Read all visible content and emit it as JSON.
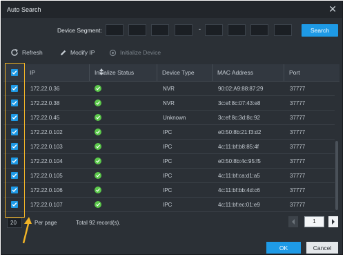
{
  "dialog": {
    "title": "Auto Search"
  },
  "segment": {
    "label": "Device Segment:",
    "separator": "-"
  },
  "actions": {
    "search": "Search",
    "ok": "OK",
    "cancel": "Cancel"
  },
  "toolbar": {
    "refresh": "Refresh",
    "modify_ip": "Modify IP",
    "initialize_device": "Initialize Device"
  },
  "table": {
    "columns": [
      "IP",
      "Initialize Status",
      "Device Type",
      "MAC Address",
      "Port"
    ],
    "rows": [
      {
        "ip": "172.22.0.36",
        "status": "initialized",
        "type": "NVR",
        "mac": "90:02:A9:88:87:29",
        "port": "37777"
      },
      {
        "ip": "172.22.0.38",
        "status": "initialized",
        "type": "NVR",
        "mac": "3c:ef:8c:07:43:e8",
        "port": "37777"
      },
      {
        "ip": "172.22.0.45",
        "status": "initialized",
        "type": "Unknown",
        "mac": "3c:ef:8c:3d:8c:92",
        "port": "37777"
      },
      {
        "ip": "172.22.0.102",
        "status": "initialized",
        "type": "IPC",
        "mac": "e0:50:8b:21:f3:d2",
        "port": "37777"
      },
      {
        "ip": "172.22.0.103",
        "status": "initialized",
        "type": "IPC",
        "mac": "4c:11:bf:b8:85:4f",
        "port": "37777"
      },
      {
        "ip": "172.22.0.104",
        "status": "initialized",
        "type": "IPC",
        "mac": "e0:50:8b:4c:95:f5",
        "port": "37777"
      },
      {
        "ip": "172.22.0.105",
        "status": "initialized",
        "type": "IPC",
        "mac": "4c:11:bf:ca:d1:a5",
        "port": "37777"
      },
      {
        "ip": "172.22.0.106",
        "status": "initialized",
        "type": "IPC",
        "mac": "4c:11:bf:bb:4d:c6",
        "port": "37777"
      },
      {
        "ip": "172.22.0.107",
        "status": "initialized",
        "type": "IPC",
        "mac": "4c:11:bf:ec:01:e9",
        "port": "37777"
      }
    ]
  },
  "pagination": {
    "page_size": "20",
    "per_page_label": "Per page",
    "total_text": "Total 92 record(s).",
    "current_page": "1"
  },
  "colors": {
    "accent": "#1e9ae6",
    "highlight": "#f0b327",
    "status_ok": "#5cc94b",
    "background": "#2b3036"
  },
  "icons": [
    "close-icon",
    "refresh-icon",
    "pencil-icon",
    "initialize-icon",
    "sort-icon",
    "checkbox-checked-icon",
    "check-circle-icon",
    "arrow-left-icon",
    "arrow-right-icon"
  ]
}
